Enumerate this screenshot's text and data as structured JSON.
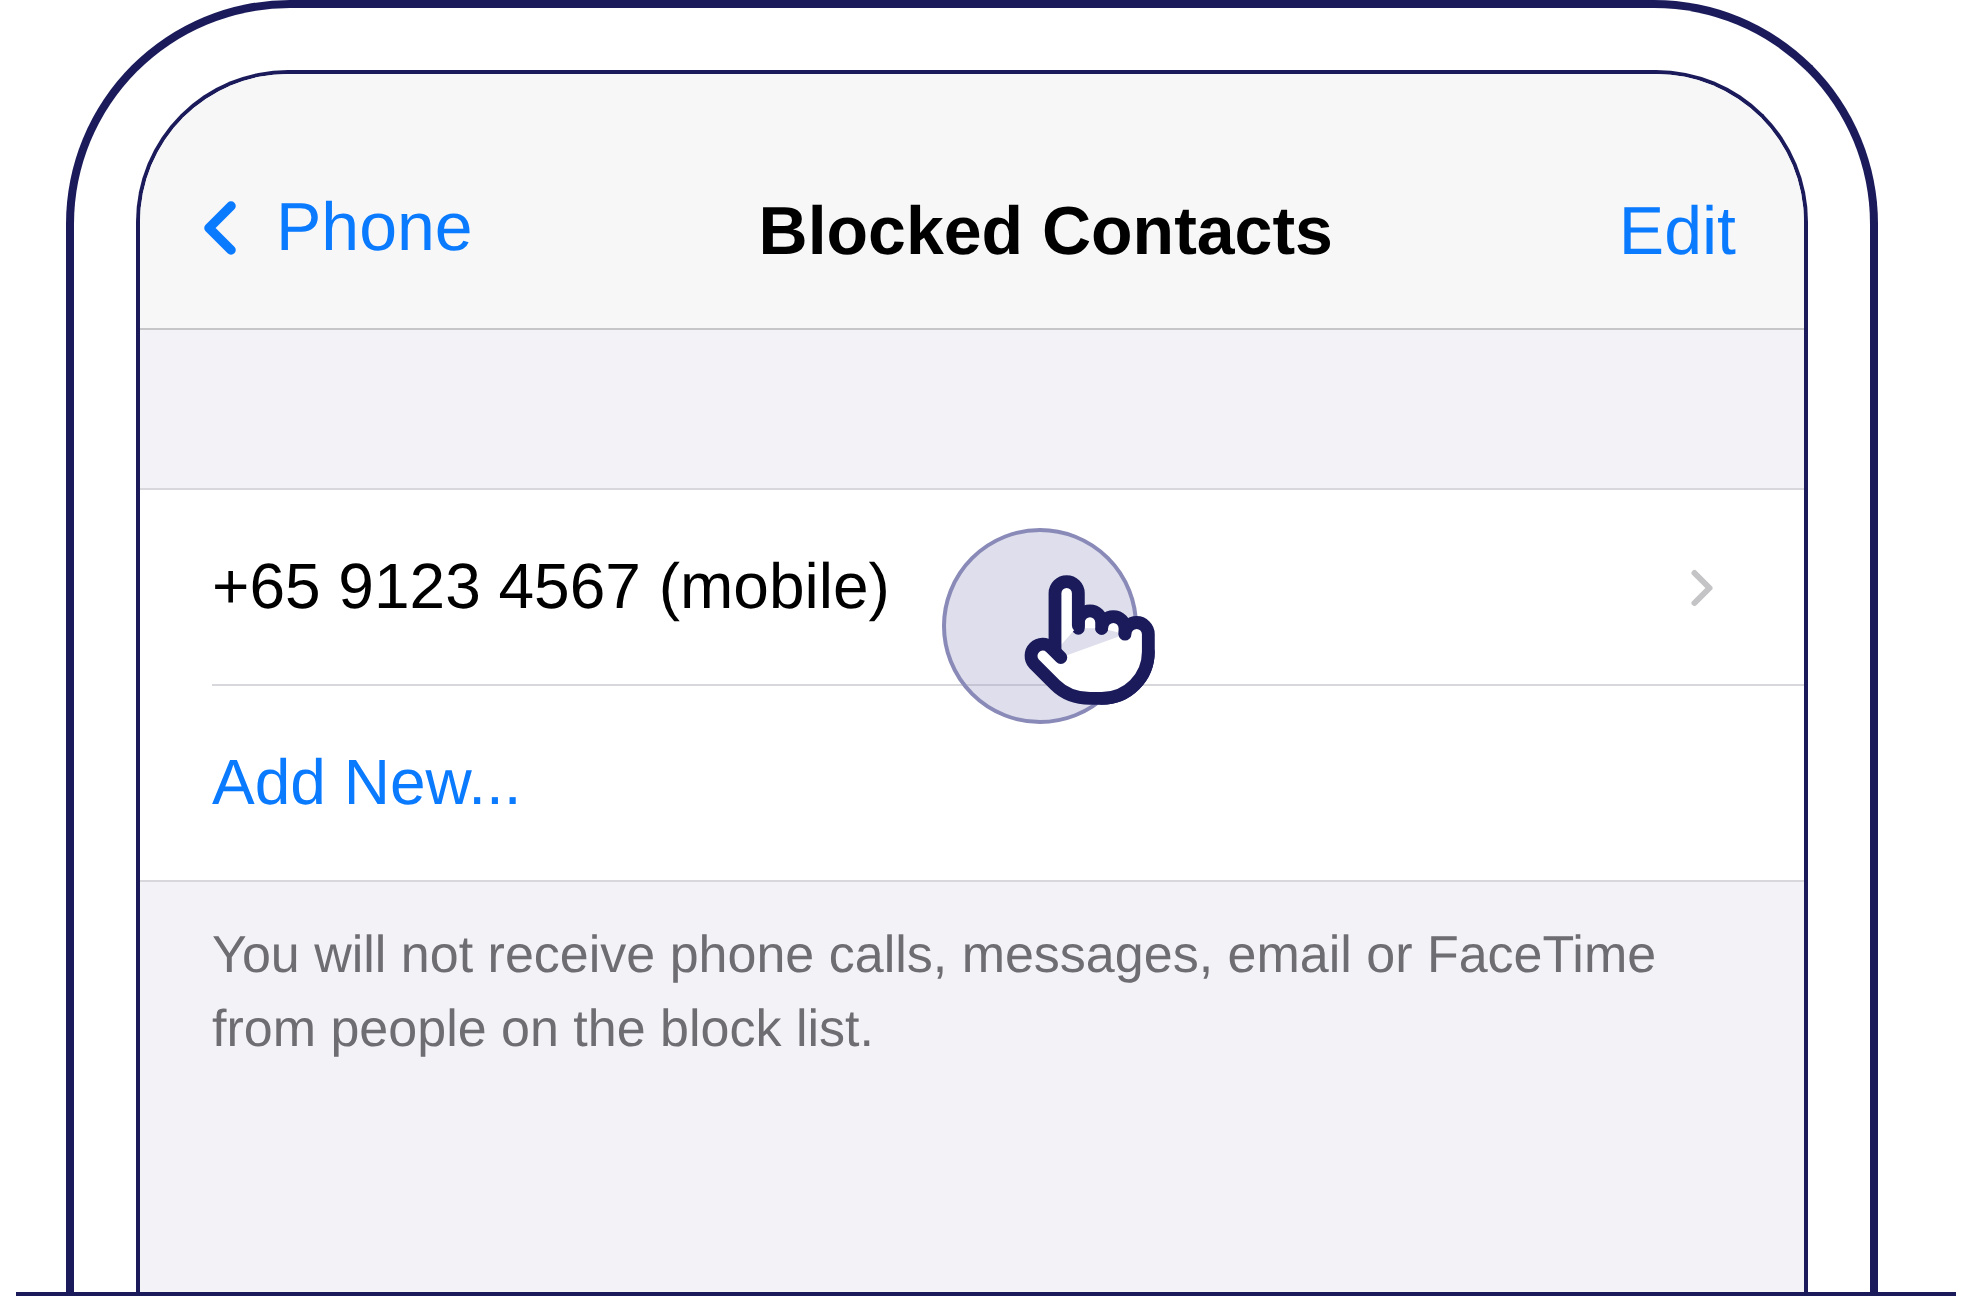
{
  "nav": {
    "back_label": "Phone",
    "title": "Blocked Contacts",
    "action": "Edit"
  },
  "rows": [
    {
      "kind": "contact",
      "text": "+65 9123 4567 (mobile)"
    },
    {
      "kind": "action",
      "text": "Add New..."
    }
  ],
  "footer": "You will not receive phone calls, messages, email or FaceTime from people on the block list."
}
